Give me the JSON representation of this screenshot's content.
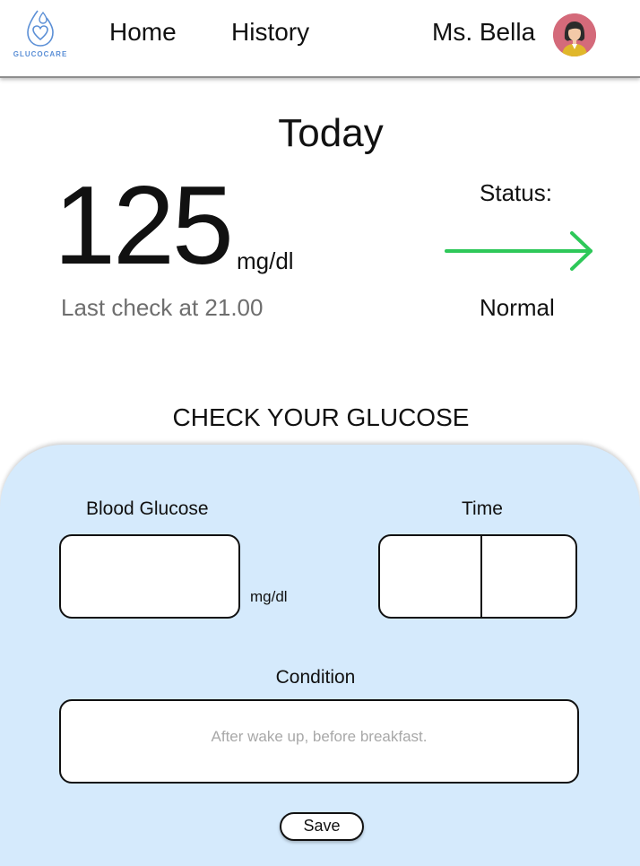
{
  "app": {
    "logo_text": "GLUCOCARE",
    "brand_color": "#5b8fd6"
  },
  "nav": {
    "home_label": "Home",
    "history_label": "History",
    "user_name": "Ms. Bella"
  },
  "today": {
    "title": "Today",
    "reading_value": "125",
    "reading_unit": "mg/dl",
    "last_check": "Last check at 21.00",
    "status_label": "Status:",
    "status_value": "Normal",
    "status_icon": "right-arrow-icon",
    "status_color": "#2ec859"
  },
  "check": {
    "title": "CHECK YOUR GLUCOSE",
    "panel_color": "#d5eafc",
    "blood_glucose_label": "Blood Glucose",
    "blood_glucose_value": "",
    "blood_glucose_unit": "mg/dl",
    "time_label": "Time",
    "time_hour_value": "",
    "time_minute_value": "",
    "condition_label": "Condition",
    "condition_placeholder": "After wake up, before breakfast.",
    "save_label": "Save"
  }
}
